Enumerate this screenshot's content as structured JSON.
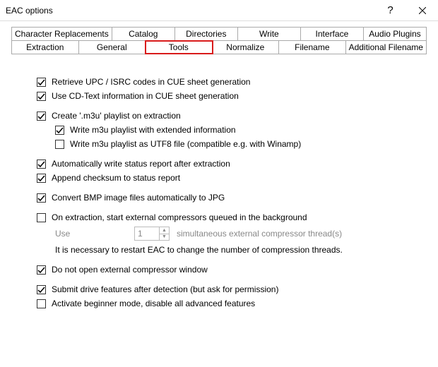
{
  "window": {
    "title": "EAC options"
  },
  "tabs": {
    "row1": [
      "Character Replacements",
      "Catalog",
      "Directories",
      "Write",
      "Interface",
      "Audio Plugins"
    ],
    "row2": [
      "Extraction",
      "General",
      "Tools",
      "Normalize",
      "Filename",
      "Additional Filename"
    ],
    "active": "Tools"
  },
  "options": {
    "retrieve_upc": {
      "label": "Retrieve UPC / ISRC codes in CUE sheet generation",
      "checked": true
    },
    "use_cdtext": {
      "label": "Use CD-Text information in CUE sheet generation",
      "checked": true
    },
    "create_m3u": {
      "label": "Create '.m3u' playlist on extraction",
      "checked": true
    },
    "m3u_extended": {
      "label": "Write m3u playlist with extended information",
      "checked": true
    },
    "m3u_utf8": {
      "label": "Write m3u playlist as UTF8 file (compatible e.g. with Winamp)",
      "checked": false
    },
    "auto_status": {
      "label": "Automatically write status report after extraction",
      "checked": true
    },
    "append_checksum": {
      "label": "Append checksum to status report",
      "checked": true
    },
    "convert_bmp": {
      "label": "Convert BMP image files automatically to JPG",
      "checked": true
    },
    "ext_compress": {
      "label": "On extraction, start external compressors queued in the background",
      "checked": false
    },
    "threads": {
      "use_label": "Use",
      "value": "1",
      "suffix": "simultaneous external compressor thread(s)"
    },
    "restart_note": "It is necessary to restart EAC to change the number of compression threads.",
    "no_open_window": {
      "label": "Do not open external compressor window",
      "checked": true
    },
    "submit_drive": {
      "label": "Submit drive features after detection (but ask for permission)",
      "checked": true
    },
    "beginner_mode": {
      "label": "Activate beginner mode, disable all advanced features",
      "checked": false
    }
  }
}
